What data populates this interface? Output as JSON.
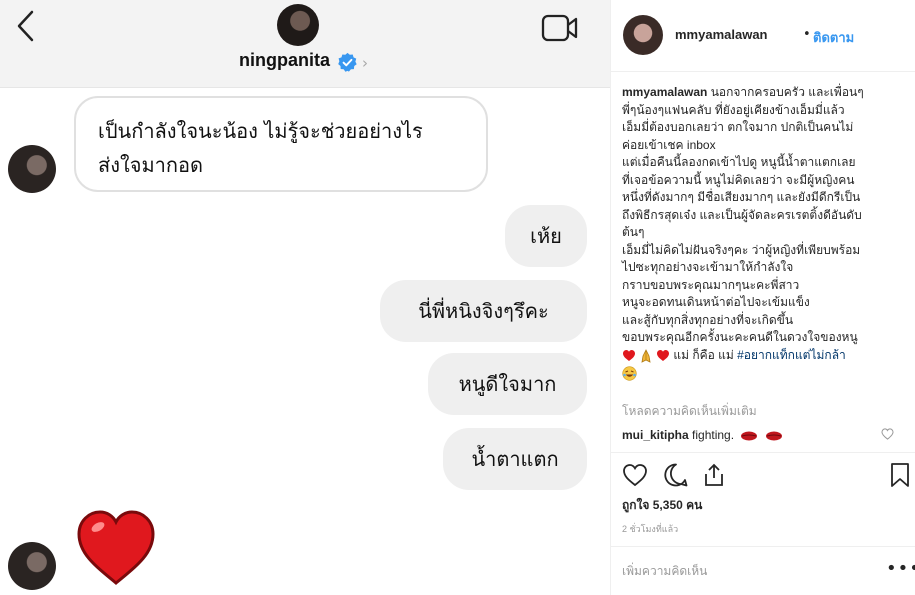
{
  "chat": {
    "header": {
      "username": "ningpanita"
    },
    "messages_in": [
      "เป็นกำลังใจนะน้อง ไม่รู้จะช่วยอย่างไร",
      "ส่งใจมากอด"
    ],
    "messages_out": [
      "เห้ย",
      "นี่พี่หนิงจิงๆรึคะ",
      "หนูดีใจมาก",
      "น้ำตาแตก"
    ],
    "icons": [
      "back-arrow-icon",
      "video-camera-icon",
      "verified-badge-icon",
      "chevron-right-icon",
      "red-heart-icon"
    ]
  },
  "post": {
    "author": "mmyamalawan",
    "separator": "•",
    "follow_label": "ติดตาม",
    "caption_user": "mmyamalawan",
    "caption_lines": [
      " นอกจากครอบครัว และเพื่อนๆ",
      "พี่ๆน้องๆแฟนคลับ ที่ยังอยู่เคียงข้างเอ็มมี่แล้ว",
      "เอ็มมี่ต้องบอกเลยว่า ตกใจมาก ปกติเป็นคนไม่",
      "ค่อยเข้าเชค inbox",
      "แต่เมื่อคืนนี้ลองกดเข้าไปดู หนูนี้น้ำตาแตกเลย",
      "ที่เจอข้อความนี้ หนูไม่คิดเลยว่า จะมีผู้หญิงคน",
      "หนึ่งที่ดังมากๆ มีชื่อเสียงมากๆ และยังมีดีกรีเป็น",
      "ถึงพิธีกรสุดเจ๋ง และเป็นผู้จัดละครเรตติ้งดีอันดับ",
      "ต้นๆ",
      "เอ็มมี่ไม่คิดไม่ฝันจริงๆคะ ว่าผู้หญิงที่เพียบพร้อม",
      "ไปซะทุกอย่างจะเข้ามาให้กำลังใจ",
      "กราบขอบพระคุณมากๆนะคะพี่สาว",
      "หนูจะอดทนเดินหน้าต่อไปจะเข้มแข็ง",
      "และสู้กับทุกสิ่งทุกอย่างที่จะเกิดขึ้น",
      "ขอบพระคุณอีกครั้งนะคะคนดีในดวงใจของหนู"
    ],
    "emoji_line_text": " แม่ ก็คือ แม่ ",
    "hashtag": "#อยากแท็กแต่ไม่กล้า",
    "load_more": "โหลดความคิดเห็นเพิ่มเติม",
    "comment": {
      "user": "mui_kitipha",
      "text": " fighting."
    },
    "likes": "ถูกใจ 5,350 คน",
    "time": "2 ชั่วโมงที่แล้ว",
    "add_comment_placeholder": "เพิ่มความคิดเห็น",
    "more_label": "•••",
    "colors": {
      "link": "#3897f0",
      "hashtag": "#003569",
      "bubble_out": "#efefef",
      "muted": "#999999"
    }
  }
}
